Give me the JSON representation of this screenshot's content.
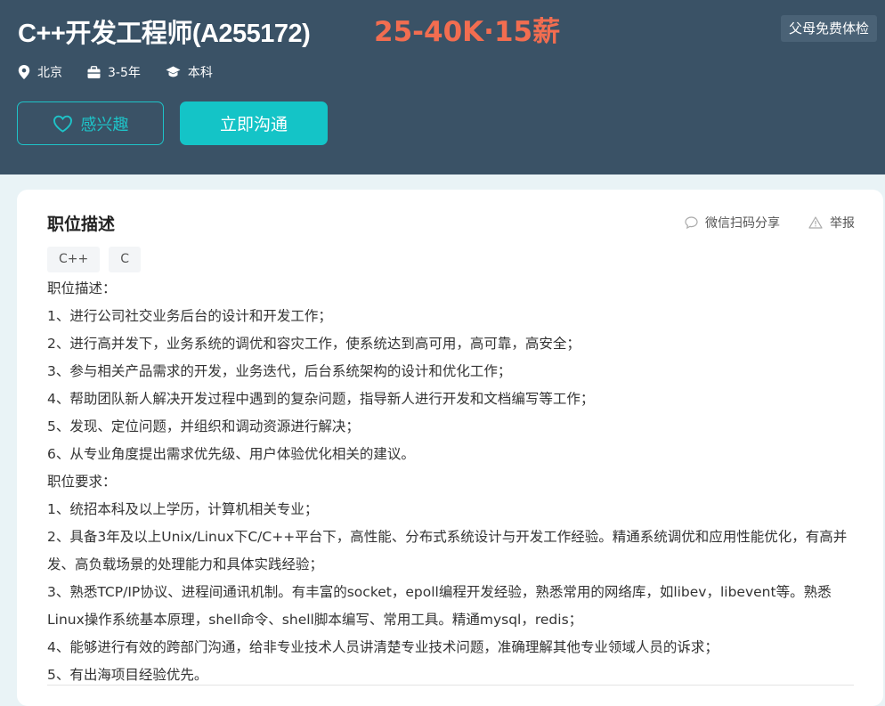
{
  "header": {
    "job_title": "C++开发工程师(A255172)",
    "salary": "25-40K·15薪",
    "benefit_tag": "父母免费体检",
    "meta": {
      "city": "北京",
      "experience": "3-5年",
      "education": "本科"
    },
    "buttons": {
      "interest": "感兴趣",
      "chat": "立即沟通"
    }
  },
  "card": {
    "section_title": "职位描述",
    "actions": {
      "share": "微信扫码分享",
      "report": "举报"
    },
    "tags": [
      "C++",
      "C"
    ],
    "description_lines": [
      "职位描述：",
      "1、进行公司社交业务后台的设计和开发工作；",
      "2、进行高并发下，业务系统的调优和容灾工作，使系统达到高可用，高可靠，高安全；",
      "3、参与相关产品需求的开发，业务迭代，后台系统架构的设计和优化工作；",
      "4、帮助团队新人解决开发过程中遇到的复杂问题，指导新人进行开发和文档编写等工作；",
      "5、发现、定位问题，并组织和调动资源进行解决；",
      "6、从专业角度提出需求优先级、用户体验优化相关的建议。",
      "职位要求：",
      "1、统招本科及以上学历，计算机相关专业；",
      "2、具备3年及以上Unix/Linux下C/C++平台下，高性能、分布式系统设计与开发工作经验。精通系统调优和应用性能优化，有高并发、高负载场景的处理能力和具体实践经验；",
      "3、熟悉TCP/IP协议、进程间通讯机制。有丰富的socket，epoll编程开发经验，熟悉常用的网络库，如libev，libevent等。熟悉Linux操作系统基本原理，shell命令、shell脚本编写、常用工具。精通mysql，redis；",
      "4、能够进行有效的跨部门沟通，给非专业技术人员讲清楚专业技术问题，准确理解其他专业领域人员的诉求；",
      "5、有出海项目经验优先。"
    ]
  },
  "colors": {
    "header_bg": "#3a5266",
    "salary": "#f26d50",
    "accent": "#14c4c7"
  }
}
